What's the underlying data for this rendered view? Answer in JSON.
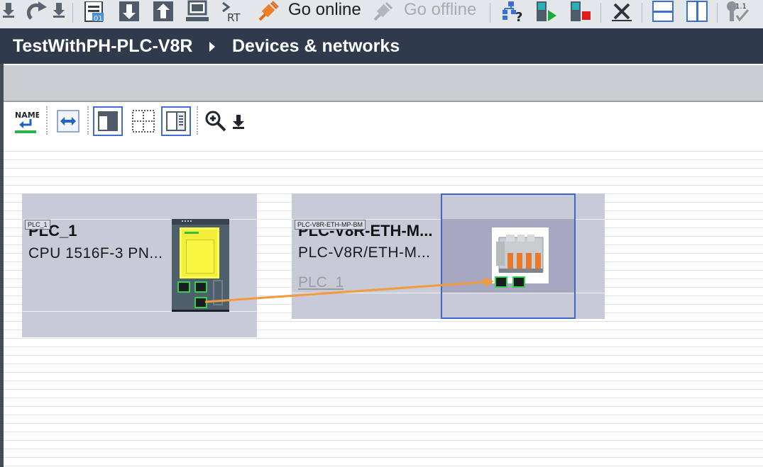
{
  "toolbar": {
    "go_online_label": "Go online",
    "go_offline_label": "Go offline"
  },
  "header": {
    "project_name": "TestWithPH-PLC-V8R",
    "page_name": "Devices & networks"
  },
  "editor_toolbar": {
    "name_icon_text": "NAME"
  },
  "devices": [
    {
      "tag": "PLC_1",
      "name": "PLC_1",
      "type": "CPU 1516F-3 PN..."
    },
    {
      "tag": "PLC-V8R-ETH-MP-BM",
      "name": "PLC-V8R-ETH-M...",
      "type": "PLC-V8R/ETH-M...",
      "assigned_plc": "PLC_1"
    }
  ],
  "colors": {
    "header_bg": "#2f3a4d",
    "connection": "#f39a3a",
    "selection": "#3c69c8",
    "port_border": "#33d04a"
  }
}
